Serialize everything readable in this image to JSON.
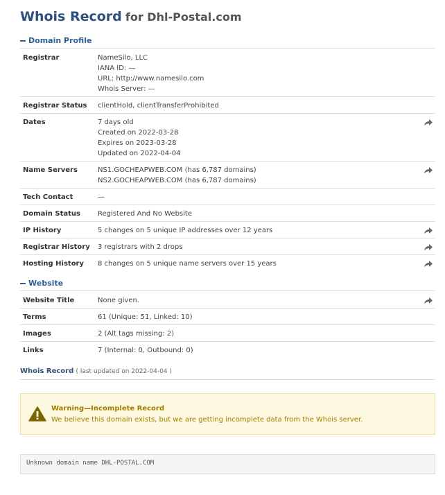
{
  "title": {
    "main": "Whois Record",
    "sub": "for Dhl-Postal.com"
  },
  "sections": {
    "domain_profile": "Domain Profile",
    "website": "Website"
  },
  "profile_rows": [
    {
      "label": "Registrar",
      "lines": [
        "NameSilo, LLC",
        "IANA ID: —",
        "URL: http://www.namesilo.com",
        "Whois Server: —"
      ],
      "share": false
    },
    {
      "label": "Registrar Status",
      "lines": [
        "clientHold, clientTransferProhibited"
      ],
      "share": false
    },
    {
      "label": "Dates",
      "lines": [
        "7 days old",
        "Created on 2022-03-28",
        "Expires on 2023-03-28",
        "Updated on 2022-04-04"
      ],
      "share": true
    },
    {
      "label": "Name Servers",
      "lines": [
        "NS1.GOCHEAPWEB.COM (has 6,787 domains)",
        "NS2.GOCHEAPWEB.COM (has 6,787 domains)"
      ],
      "share": true
    },
    {
      "label": "Tech Contact",
      "lines": [
        "—"
      ],
      "share": false
    },
    {
      "label": "Domain Status",
      "lines": [
        "Registered And No Website"
      ],
      "share": false
    },
    {
      "label": "IP History",
      "lines": [
        "5 changes on 5 unique IP addresses over 12 years"
      ],
      "share": true
    },
    {
      "label": "Registrar History",
      "lines": [
        "3 registrars with 2 drops"
      ],
      "share": true
    },
    {
      "label": "Hosting History",
      "lines": [
        "8 changes on 5 unique name servers over 15 years"
      ],
      "share": true
    }
  ],
  "website_rows": [
    {
      "label": "Website Title",
      "lines": [
        "None given."
      ],
      "share": true
    },
    {
      "label": "Terms",
      "lines": [
        "61 (Unique: 51, Linked: 10)"
      ],
      "share": false
    },
    {
      "label": "Images",
      "lines": [
        "2 (Alt tags missing: 2)"
      ],
      "share": false
    },
    {
      "label": "Links",
      "lines": [
        "7   (Internal: 0, Outbound: 0)"
      ],
      "share": false
    }
  ],
  "footer": {
    "link": "Whois Record",
    "updated": "( last updated on 2022-04-04 )"
  },
  "warning": {
    "title": "Warning—Incomplete Record",
    "message": "We believe this domain exists, but we are getting incomplete data from the Whois server."
  },
  "raw_text": "Unknown domain name DHL-POSTAL.COM",
  "colors": {
    "accent": "#2f4f7c",
    "warning_bg": "#fdf9e0",
    "warning_text": "#a07d00"
  }
}
